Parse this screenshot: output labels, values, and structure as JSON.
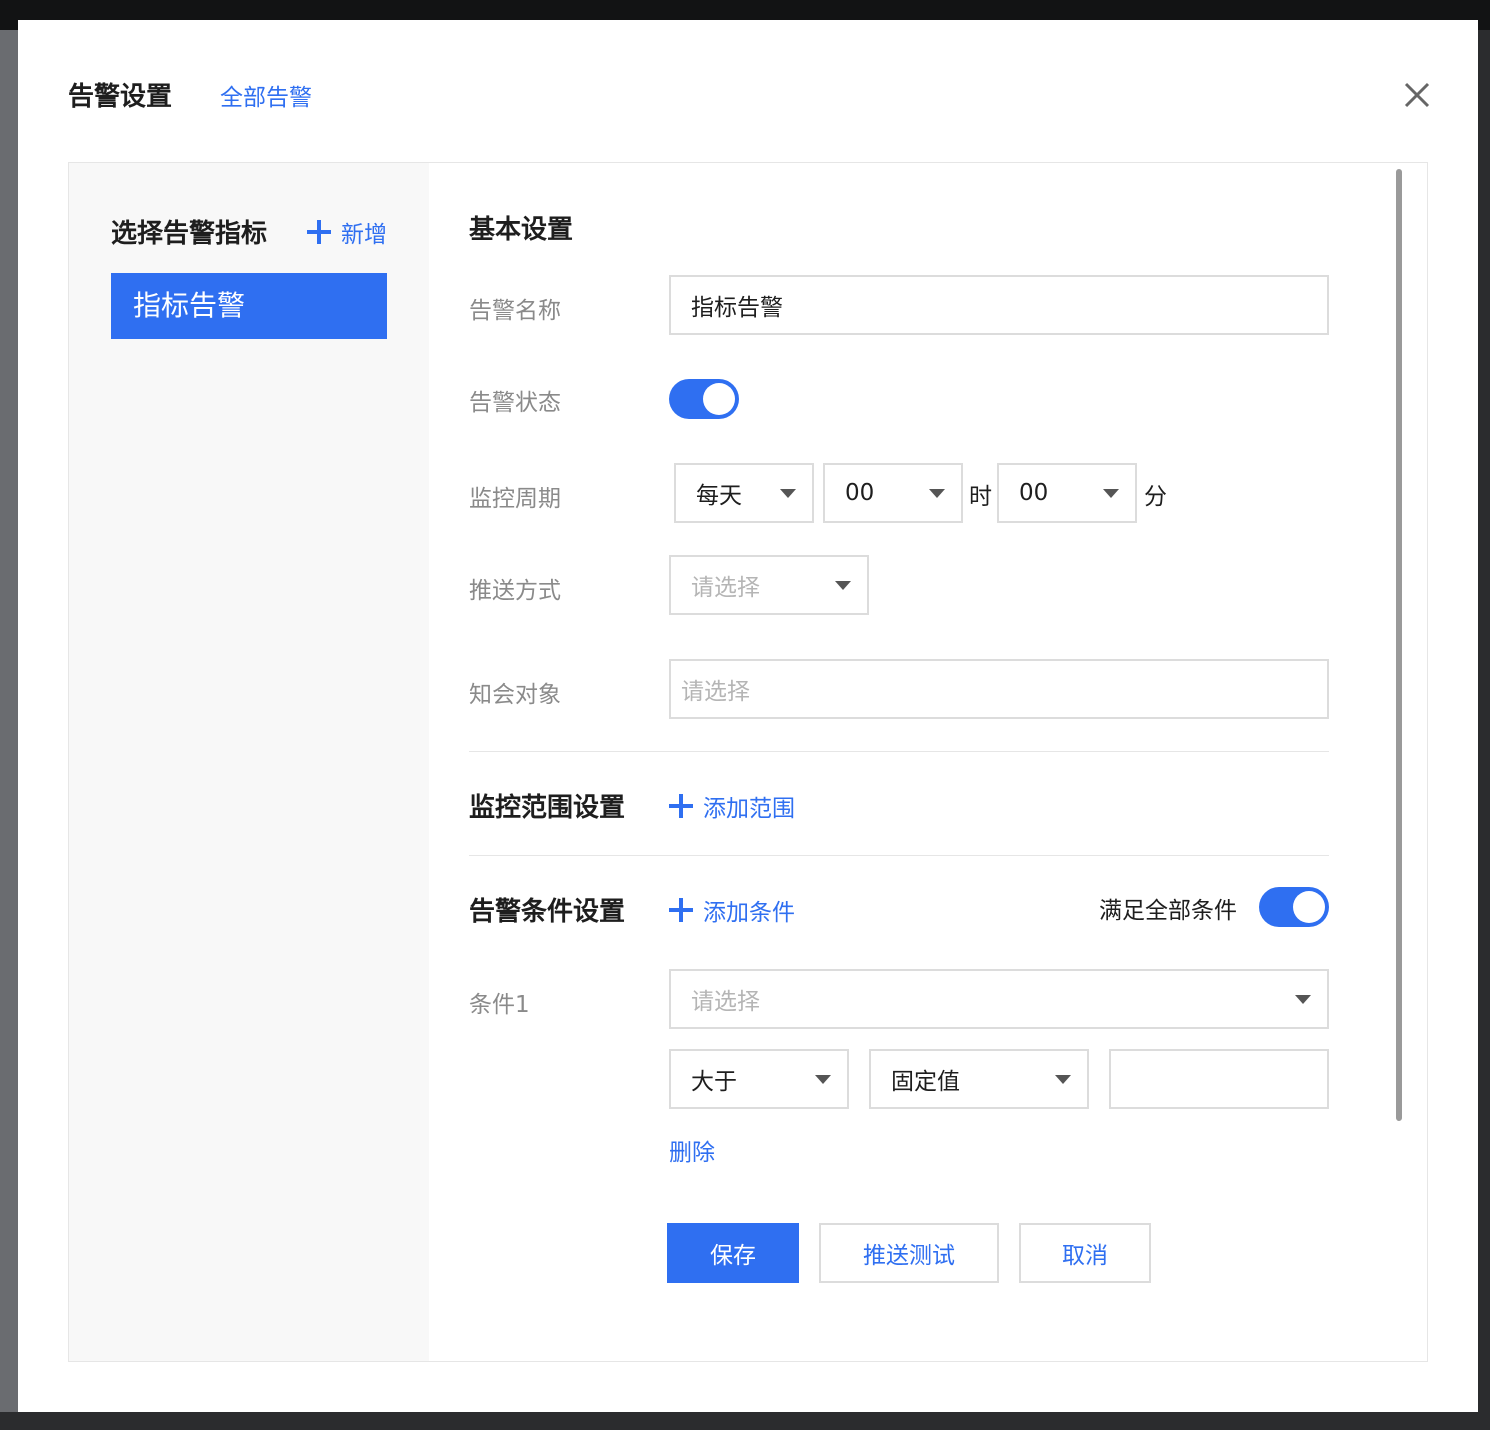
{
  "dialog": {
    "title": "告警设置",
    "all_alerts_link": "全部告警"
  },
  "sidebar": {
    "title": "选择告警指标",
    "add_label": "新增",
    "items": [
      {
        "label": "指标告警",
        "selected": true
      }
    ]
  },
  "basic": {
    "title": "基本设置",
    "name_label": "告警名称",
    "name_value": "指标告警",
    "status_label": "告警状态",
    "status_on": true,
    "cycle_label": "监控周期",
    "cycle_freq": "每天",
    "cycle_hour": "00",
    "hour_unit": "时",
    "cycle_minute": "00",
    "minute_unit": "分",
    "push_label": "推送方式",
    "push_placeholder": "请选择",
    "notify_label": "知会对象",
    "notify_placeholder": "请选择"
  },
  "scope": {
    "title": "监控范围设置",
    "add_label": "添加范围"
  },
  "conditions": {
    "title": "告警条件设置",
    "add_label": "添加条件",
    "match_all_label": "满足全部条件",
    "match_all_on": true,
    "items": [
      {
        "label": "条件1",
        "metric_placeholder": "请选择",
        "operator": "大于",
        "value_type": "固定值",
        "value": "",
        "delete_label": "删除"
      }
    ]
  },
  "actions": {
    "save": "保存",
    "push_test": "推送测试",
    "cancel": "取消"
  },
  "colors": {
    "accent": "#2f6ff1",
    "border": "#dcdcdc",
    "sidebar_bg": "#f8f8f8"
  }
}
